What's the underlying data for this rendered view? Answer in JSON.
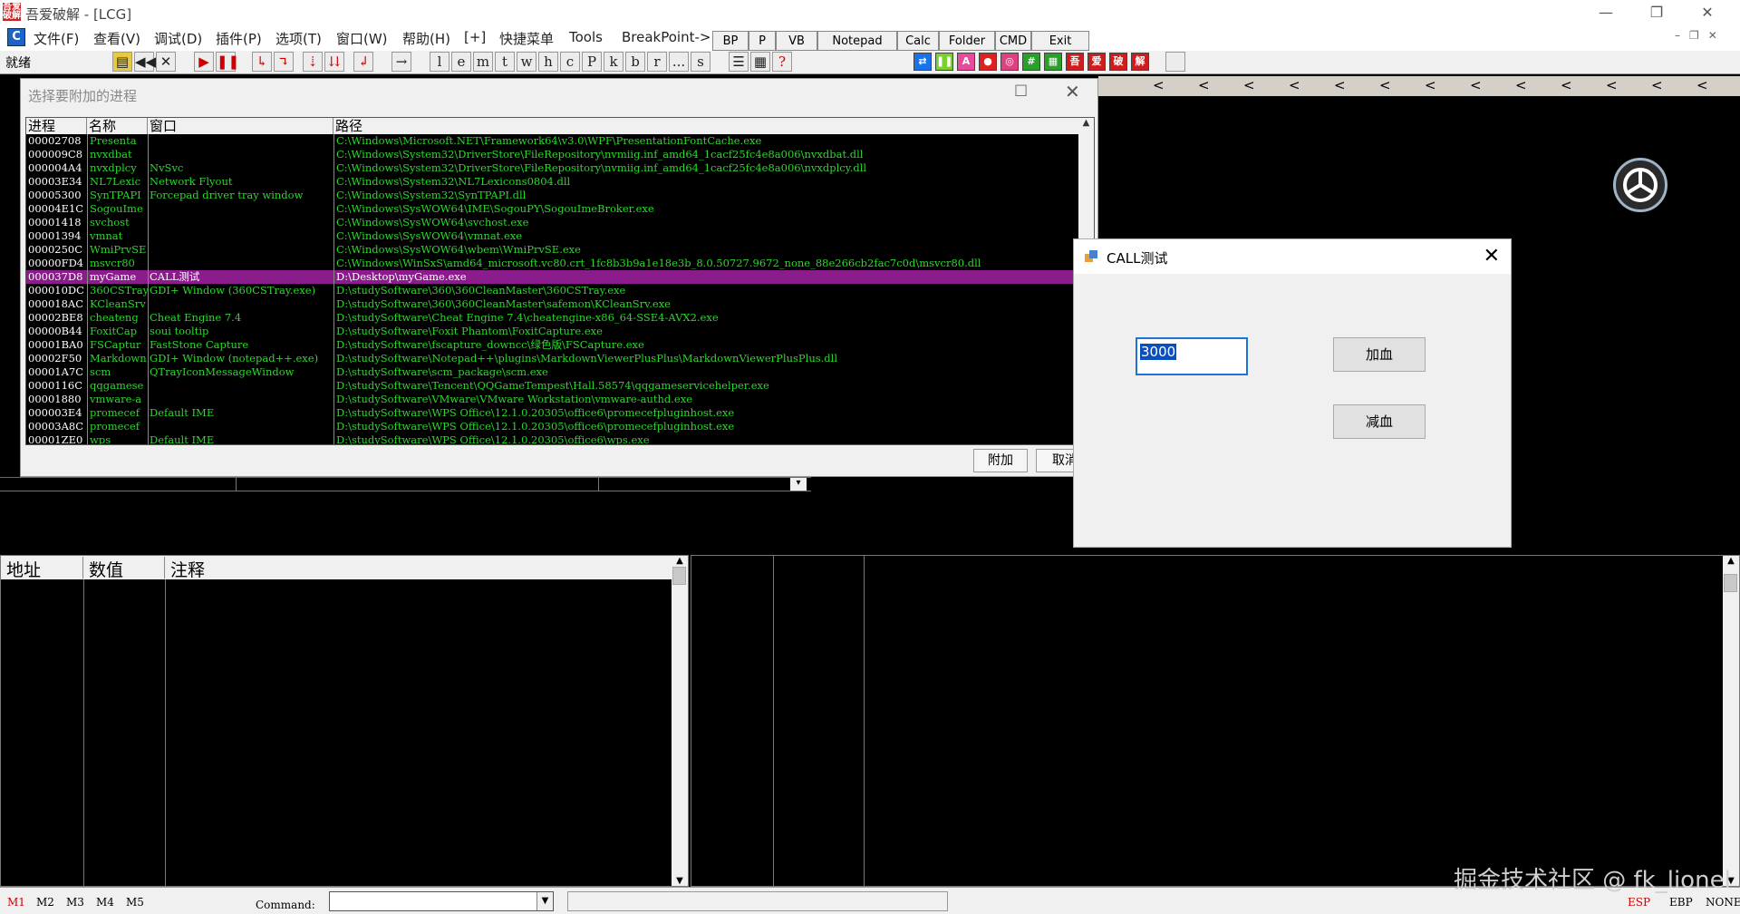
{
  "window": {
    "title": "吾爱破解 - [LCG]",
    "icon_text": "吾爱破解"
  },
  "menu": {
    "items": [
      "文件(F)",
      "查看(V)",
      "调试(D)",
      "插件(P)",
      "选项(T)",
      "窗口(W)",
      "帮助(H)",
      "[+]",
      "快捷菜单",
      "Tools",
      "BreakPoint->"
    ],
    "quick_buttons": [
      "BP",
      "P",
      "VB",
      "Notepad",
      "Calc",
      "Folder",
      "CMD",
      "Exit"
    ]
  },
  "toolbar": {
    "status": "就绪",
    "letter_buttons": [
      "l",
      "e",
      "m",
      "t",
      "w",
      "h",
      "c",
      "P",
      "k",
      "b",
      "r",
      "...",
      "s"
    ],
    "tail_buttons": [
      "吾",
      "爱",
      "破",
      "解"
    ]
  },
  "process_dialog": {
    "title": "选择要附加的进程",
    "columns": [
      "进程",
      "名称",
      "窗口",
      "路径"
    ],
    "rows": [
      [
        "00002708",
        "Presenta",
        "",
        "C:\\Windows\\Microsoft.NET\\Framework64\\v3.0\\WPF\\PresentationFontCache.exe"
      ],
      [
        "000009C8",
        "nvxdbat",
        "",
        "C:\\Windows\\System32\\DriverStore\\FileRepository\\nvmiig.inf_amd64_1cacf25fc4e8a006\\nvxdbat.dll"
      ],
      [
        "000004A4",
        "nvxdplcy",
        "NvSvc",
        "C:\\Windows\\System32\\DriverStore\\FileRepository\\nvmiig.inf_amd64_1cacf25fc4e8a006\\nvxdplcy.dll"
      ],
      [
        "00003E34",
        "NL7Lexic",
        "Network Flyout",
        "C:\\Windows\\System32\\NL7Lexicons0804.dll"
      ],
      [
        "00005300",
        "SynTPAPI",
        "Forcepad driver tray window",
        "C:\\Windows\\System32\\SynTPAPI.dll"
      ],
      [
        "00004E1C",
        "SogouIme",
        "",
        "C:\\Windows\\SysWOW64\\IME\\SogouPY\\SogouImeBroker.exe"
      ],
      [
        "00001418",
        "svchost",
        "",
        "C:\\Windows\\SysWOW64\\svchost.exe"
      ],
      [
        "00001394",
        "vmnat",
        "",
        "C:\\Windows\\SysWOW64\\vmnat.exe"
      ],
      [
        "0000250C",
        "WmiPrvSE",
        "",
        "C:\\Windows\\SysWOW64\\wbem\\WmiPrvSE.exe"
      ],
      [
        "00000FD4",
        "msvcr80",
        "",
        "C:\\Windows\\WinSxS\\amd64_microsoft.vc80.crt_1fc8b3b9a1e18e3b_8.0.50727.9672_none_88e266cb2fac7c0d\\msvcr80.dll"
      ],
      [
        "000037D8",
        "myGame",
        "CALL测试",
        "D:\\Desktop\\myGame.exe"
      ],
      [
        "000010DC",
        "360CSTray",
        "GDI+ Window (360CSTray.exe)",
        "D:\\studySoftware\\360\\360CleanMaster\\360CSTray.exe"
      ],
      [
        "000018AC",
        "KCleanSrv",
        "",
        "D:\\studySoftware\\360\\360CleanMaster\\safemon\\KCleanSrv.exe"
      ],
      [
        "00002BE8",
        "cheateng",
        "Cheat Engine 7.4",
        "D:\\studySoftware\\Cheat Engine 7.4\\cheatengine-x86_64-SSE4-AVX2.exe"
      ],
      [
        "00000B44",
        "FoxitCap",
        "soui tooltip",
        "D:\\studySoftware\\Foxit Phantom\\FoxitCapture.exe"
      ],
      [
        "00001BA0",
        "FSCaptur",
        "FastStone Capture",
        "D:\\studySoftware\\fscapture_downcc\\绿色版\\FSCapture.exe"
      ],
      [
        "00002F50",
        "Markdown",
        "GDI+ Window (notepad++.exe)",
        "D:\\studySoftware\\Notepad++\\plugins\\MarkdownViewerPlusPlus\\MarkdownViewerPlusPlus.dll"
      ],
      [
        "00001A7C",
        "scm",
        "QTrayIconMessageWindow",
        "D:\\studySoftware\\scm_package\\scm.exe"
      ],
      [
        "0000116C",
        "qqgamese",
        "",
        "D:\\studySoftware\\Tencent\\QQGameTempest\\Hall.58574\\qqgameservicehelper.exe"
      ],
      [
        "00001880",
        "vmware-a",
        "",
        "D:\\studySoftware\\VMware\\VMware Workstation\\vmware-authd.exe"
      ],
      [
        "000003E4",
        "promecef",
        "Default IME",
        "D:\\studySoftware\\WPS Office\\12.1.0.20305\\office6\\promecefpluginhost.exe"
      ],
      [
        "00003A8C",
        "promecef",
        "",
        "D:\\studySoftware\\WPS Office\\12.1.0.20305\\office6\\promecefpluginhost.exe"
      ],
      [
        "00001ZE0",
        "wps",
        "Default IME",
        "D:\\studySoftware\\WPS Office\\12.1.0.20305\\office6\\wps.exe"
      ]
    ],
    "selected_index": 10,
    "attach_label": "附加",
    "cancel_label": "取消"
  },
  "dump": {
    "columns": [
      "地址",
      "数值",
      "注释"
    ]
  },
  "call_dialog": {
    "title": "CALL测试",
    "input_value": "3000",
    "add_label": "加血",
    "sub_label": "减血"
  },
  "statusbar": {
    "tabs": [
      "M1",
      "M2",
      "M3",
      "M4",
      "M5"
    ],
    "command_label": "Command:",
    "registers": [
      "ESP",
      "EBP",
      "NONE"
    ]
  },
  "watermark": "掘金技术社区 @ fk_lionel",
  "colors": {
    "accent_green": "#2bd82b",
    "selected_row": "#8b1c8b",
    "active_tab": "#d00000"
  }
}
